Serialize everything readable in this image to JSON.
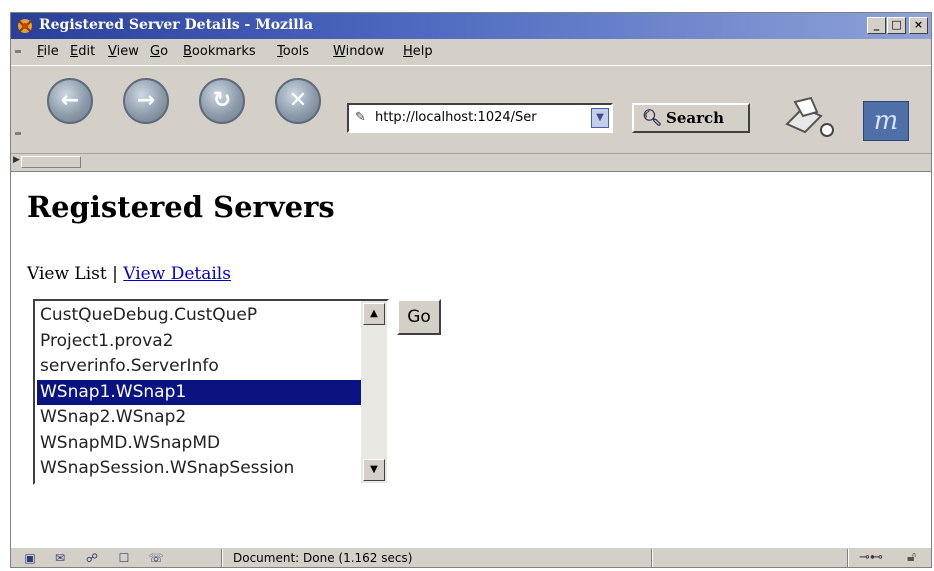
{
  "window": {
    "title": "Registered Server Details - Mozilla"
  },
  "menubar": {
    "items": [
      {
        "label": "File",
        "key": "F",
        "rest": "ile"
      },
      {
        "label": "Edit",
        "key": "E",
        "rest": "dit"
      },
      {
        "label": "View",
        "key": "V",
        "rest": "iew"
      },
      {
        "label": "Go",
        "key": "G",
        "rest": "o"
      },
      {
        "label": "Bookmarks",
        "key": "B",
        "rest": "ookmarks"
      },
      {
        "label": "Tools",
        "key": "T",
        "rest": "ools"
      },
      {
        "label": "Window",
        "key": "W",
        "rest": "indow"
      },
      {
        "label": "Help",
        "key": "H",
        "rest": "elp"
      }
    ]
  },
  "navbar": {
    "url": "http://localhost:1024/Ser",
    "search_label": "Search"
  },
  "page": {
    "title": "Registered Servers",
    "view_list": "View List",
    "separator": " | ",
    "view_details": "View Details",
    "list_items": [
      "CustQueDebug.CustQueP",
      "Project1.prova2",
      "serverinfo.ServerInfo",
      "WSnap1.WSnap1",
      "WSnap2.WSnap2",
      "WSnapMD.WSnapMD",
      "WSnapSession.WSnapSession"
    ],
    "selected_index": 3,
    "go_label": "Go"
  },
  "statusbar": {
    "text": "Document: Done (1.162 secs)"
  },
  "colors": {
    "title_gradient_start": "#2a3f97",
    "selection": "#0a1382",
    "link": "#0000cc",
    "chrome": "#d4d0c8"
  }
}
